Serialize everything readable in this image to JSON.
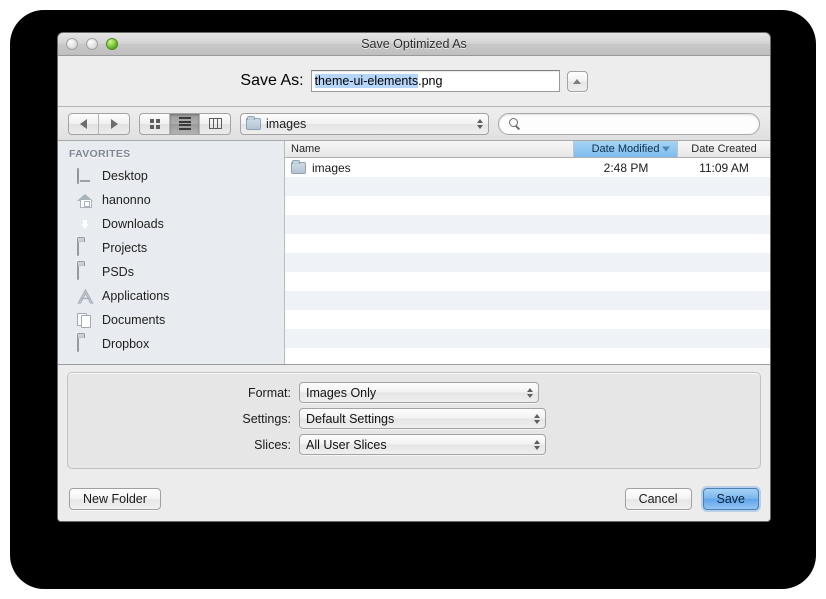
{
  "window": {
    "title": "Save Optimized As",
    "traffic_lights": [
      {
        "name": "close-button",
        "state": "disabled"
      },
      {
        "name": "minimize-button",
        "state": "disabled"
      },
      {
        "name": "zoom-button",
        "state": "enabled",
        "color": "#6ec02a"
      }
    ]
  },
  "saveas": {
    "label": "Save As:",
    "value_selected": "theme-ui-elements",
    "value_rest": ".png",
    "full_value": "theme-ui-elements.png",
    "selection_color": "#b5d6fa",
    "collapse_icon": "triangle-up-icon"
  },
  "toolbar": {
    "nav": {
      "back_icon": "chevron-left-icon",
      "forward_icon": "chevron-right-icon"
    },
    "view_modes": [
      {
        "name": "icon-view",
        "icon": "grid-icon",
        "selected": false
      },
      {
        "name": "list-view",
        "icon": "list-icon",
        "selected": true
      },
      {
        "name": "column-view",
        "icon": "columns-icon",
        "selected": false
      }
    ],
    "path": {
      "icon": "folder-icon",
      "label": "images",
      "stepper_icon": "up-down-arrows-icon"
    },
    "search": {
      "icon": "search-icon",
      "value": "",
      "placeholder": ""
    }
  },
  "sidebar": {
    "header": "FAVORITES",
    "items": [
      {
        "label": "Desktop",
        "icon": "desktop-icon"
      },
      {
        "label": "hanonno",
        "icon": "home-icon"
      },
      {
        "label": "Downloads",
        "icon": "download-icon"
      },
      {
        "label": "Projects",
        "icon": "folder-icon"
      },
      {
        "label": "PSDs",
        "icon": "folder-icon"
      },
      {
        "label": "Applications",
        "icon": "applications-icon"
      },
      {
        "label": "Documents",
        "icon": "documents-icon"
      },
      {
        "label": "Dropbox",
        "icon": "folder-icon"
      }
    ]
  },
  "filelist": {
    "columns": [
      {
        "label": "Name",
        "sorted": false
      },
      {
        "label": "Date Modified",
        "sorted": true,
        "direction": "descending",
        "highlight_color": "#7dbdee"
      },
      {
        "label": "Date Created",
        "sorted": false
      }
    ],
    "rows": [
      {
        "name": "images",
        "icon": "folder-icon",
        "date_modified": "2:48 PM",
        "date_created": "11:09 AM"
      }
    ],
    "empty_row_count": 9
  },
  "options": {
    "rows": [
      {
        "label": "Format:",
        "value": "Images Only",
        "width": "240"
      },
      {
        "label": "Settings:",
        "value": "Default Settings",
        "width": "247"
      },
      {
        "label": "Slices:",
        "value": "All User Slices",
        "width": "247"
      }
    ]
  },
  "footer": {
    "new_folder": "New Folder",
    "cancel": "Cancel",
    "save": "Save",
    "default_button_color": "#5ea4e8"
  }
}
